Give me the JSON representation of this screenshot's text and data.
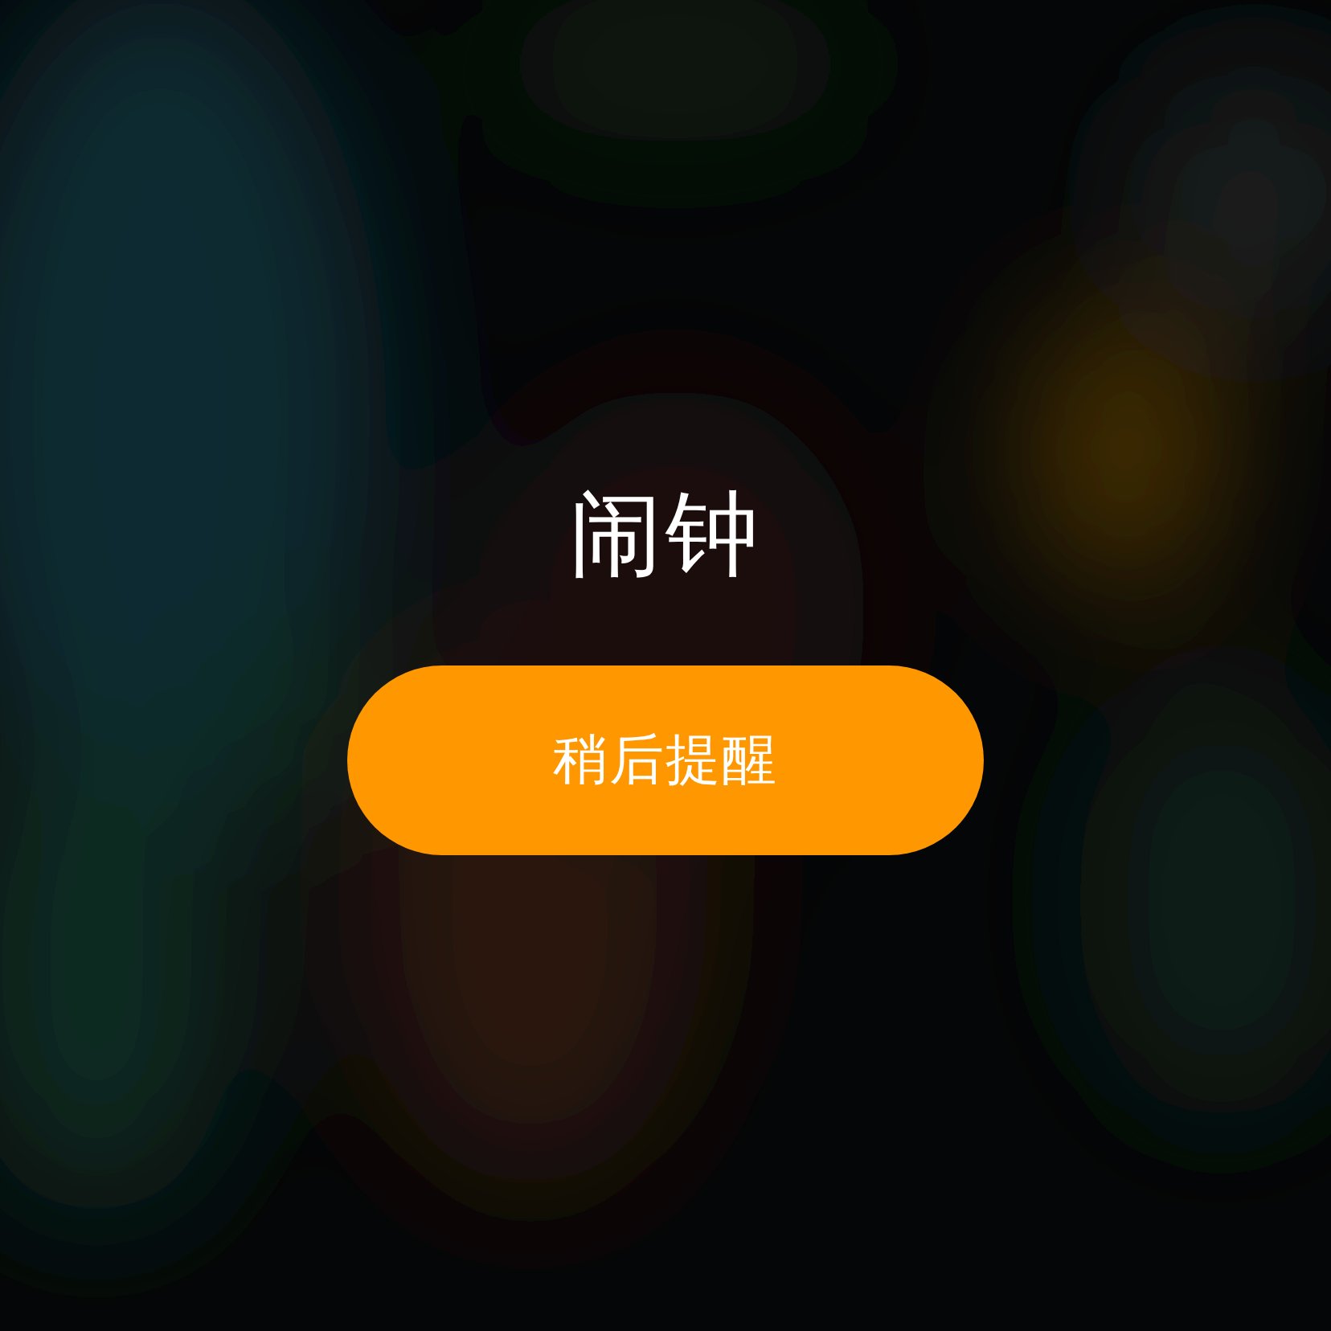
{
  "title": "闹钟",
  "snooze_button": "稍后提醒"
}
